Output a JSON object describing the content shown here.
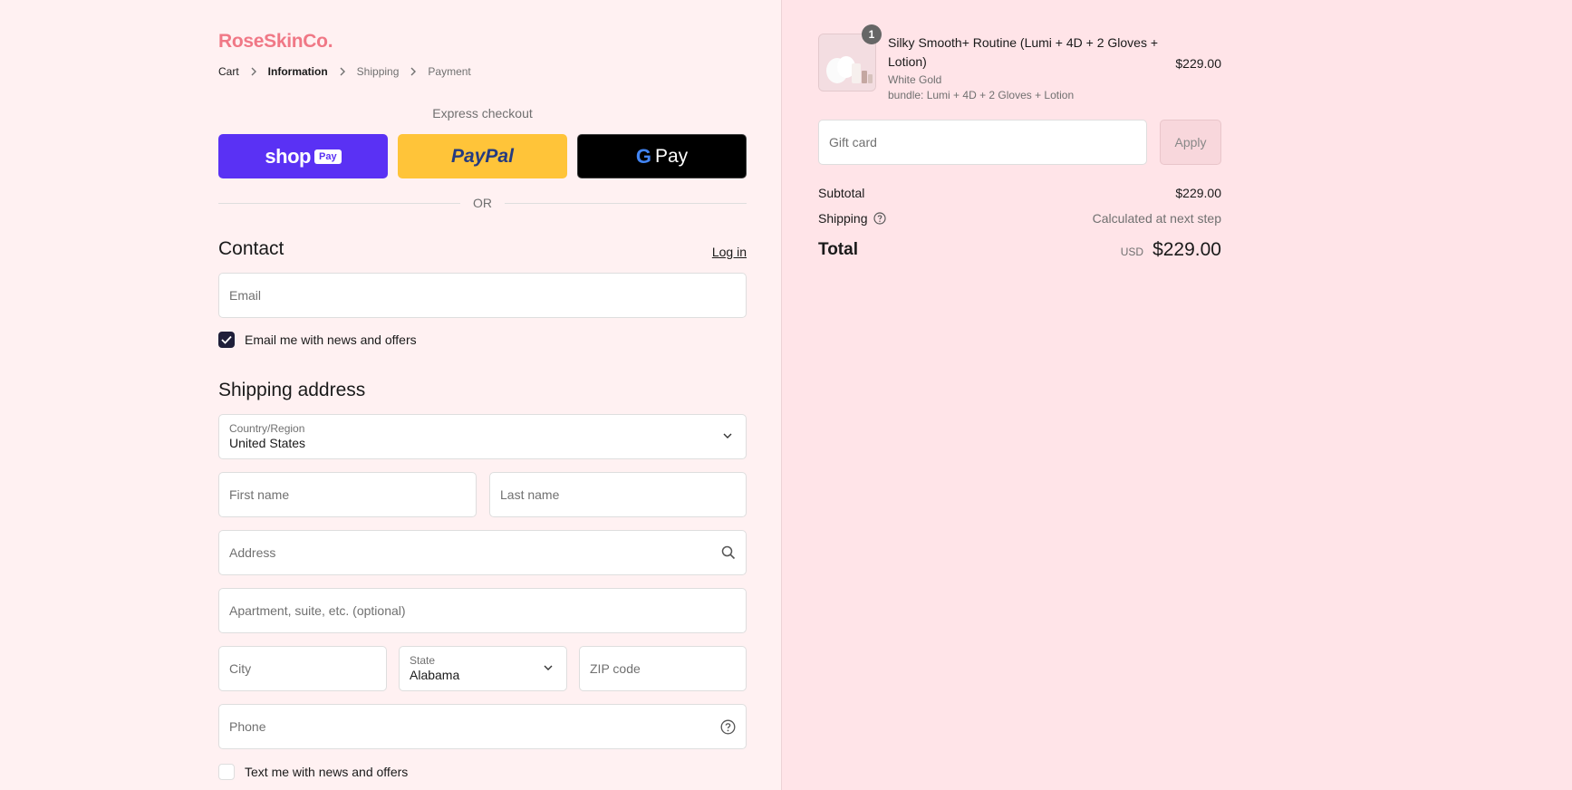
{
  "brand": {
    "logo_text": "RoseSkinCo.",
    "color": "#f07886"
  },
  "breadcrumb": [
    {
      "label": "Cart"
    },
    {
      "label": "Information"
    },
    {
      "label": "Shipping"
    },
    {
      "label": "Payment"
    }
  ],
  "express": {
    "label": "Express checkout",
    "or_text": "OR",
    "buttons": [
      {
        "name": "Shop Pay",
        "logo_text": "shop",
        "badge": "Pay",
        "color": "#5a31f4"
      },
      {
        "name": "PayPal",
        "logo_text": "PayPal",
        "color": "#ffc439"
      },
      {
        "name": "Google Pay",
        "logo_text": "Pay",
        "color": "#000000"
      }
    ]
  },
  "contact": {
    "title": "Contact",
    "login_label": "Log in",
    "email_placeholder": "Email",
    "news_checkbox_label": "Email me with news and offers",
    "news_checked": true
  },
  "shipping": {
    "title": "Shipping address",
    "country_label": "Country/Region",
    "country_value": "United States",
    "first_name_placeholder": "First name",
    "last_name_placeholder": "Last name",
    "address_placeholder": "Address",
    "apartment_placeholder": "Apartment, suite, etc. (optional)",
    "city_placeholder": "City",
    "state_label": "State",
    "state_value": "Alabama",
    "zip_placeholder": "ZIP code",
    "phone_placeholder": "Phone",
    "text_checkbox_label": "Text me with news and offers",
    "text_checked": false
  },
  "summary": {
    "product": {
      "quantity": "1",
      "name": "Silky Smooth+ Routine (Lumi + 4D + 2 Gloves + Lotion)",
      "variant": "White Gold",
      "bundle": "bundle: Lumi + 4D + 2 Gloves + Lotion",
      "price": "$229.00"
    },
    "gift_card_placeholder": "Gift card",
    "apply_label": "Apply",
    "subtotal_label": "Subtotal",
    "subtotal_value": "$229.00",
    "shipping_label": "Shipping",
    "shipping_value": "Calculated at next step",
    "total_label": "Total",
    "total_currency": "USD",
    "total_value": "$229.00"
  }
}
